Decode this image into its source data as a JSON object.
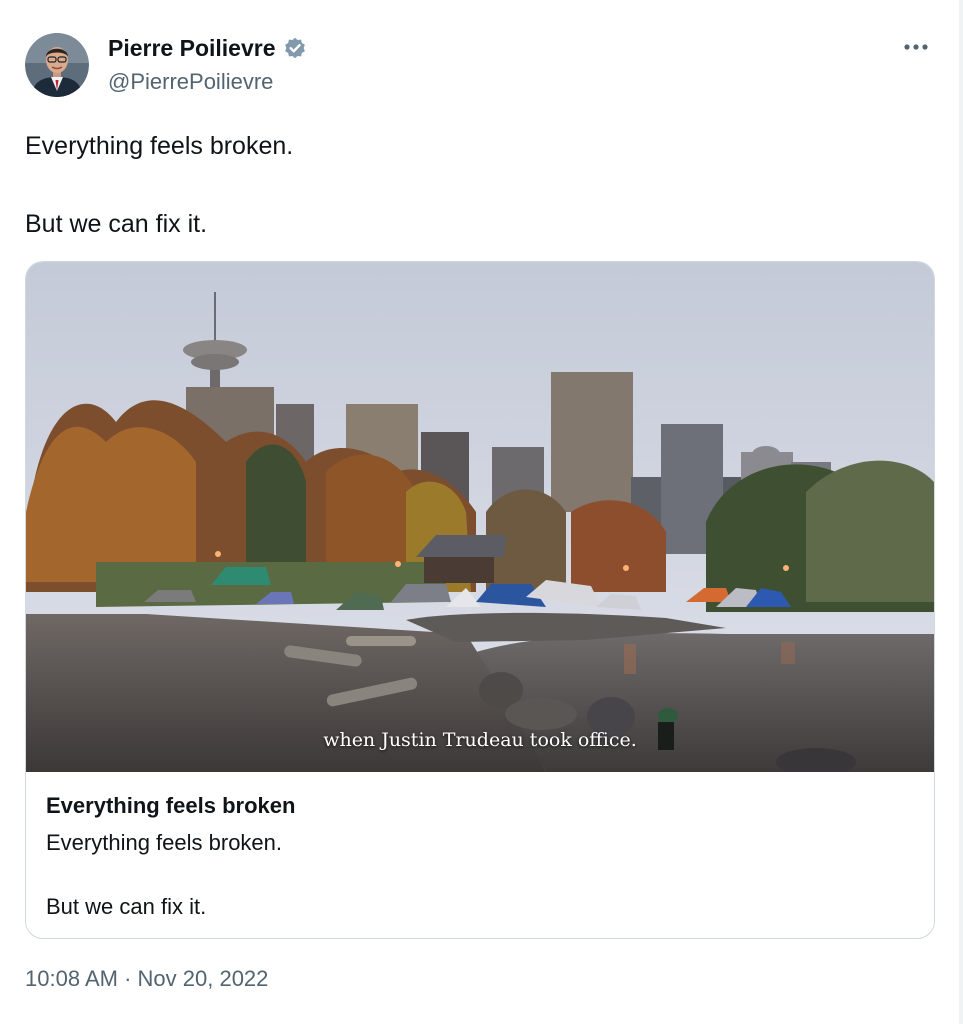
{
  "author": {
    "display_name": "Pierre Poilievre",
    "handle": "@PierrePoilievre",
    "verified": true,
    "verified_icon": "verified-badge-icon"
  },
  "menu": {
    "icon": "more-options-icon"
  },
  "tweet": {
    "lines": [
      "Everything feels broken.",
      "But we can fix it."
    ]
  },
  "card": {
    "media_caption": "when Justin Trudeau took office.",
    "title": "Everything feels broken",
    "description": [
      "Everything feels broken.",
      "But we can fix it."
    ]
  },
  "meta": {
    "time": "10:08 AM",
    "separator": "·",
    "date": "Nov 20, 2022"
  },
  "colors": {
    "text": "#0f1419",
    "secondary": "#536471",
    "border": "#cfd9de",
    "verified": "#829aab"
  }
}
